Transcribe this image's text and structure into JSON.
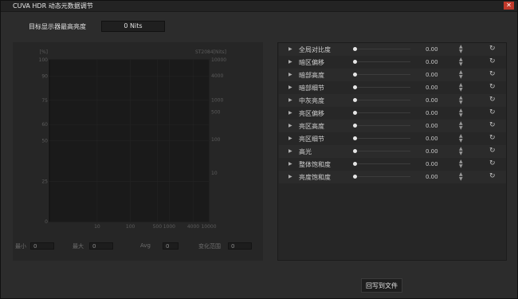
{
  "window": {
    "title": "CUVA HDR 动态元数据调节",
    "close_glyph": "✕"
  },
  "target": {
    "label": "目标显示器最高亮度",
    "value": "0 Nits"
  },
  "chart_data": {
    "type": "line",
    "left_axis": {
      "unit": "[%]",
      "ticks": [
        "100",
        "90",
        "75",
        "60",
        "50",
        "25",
        "0"
      ]
    },
    "right_axis": {
      "unit": "ST2084[Nits]",
      "ticks": [
        "10000",
        "4000",
        "1000",
        "500",
        "100",
        "10"
      ]
    },
    "x_axis": {
      "ticks": [
        "10",
        "100",
        "500",
        "1000",
        "4000",
        "10000"
      ]
    },
    "series": []
  },
  "stats": [
    {
      "label": "最小",
      "value": "0"
    },
    {
      "label": "最大",
      "value": "0"
    },
    {
      "label": "Avg",
      "value": "0"
    },
    {
      "label": "变化范围",
      "value": "0"
    }
  ],
  "params": [
    {
      "label": "全局对比度",
      "value": "0.00"
    },
    {
      "label": "暗区偏移",
      "value": "0.00"
    },
    {
      "label": "暗部高度",
      "value": "0.00"
    },
    {
      "label": "暗部细节",
      "value": "0.00"
    },
    {
      "label": "中灰亮度",
      "value": "0.00"
    },
    {
      "label": "亮区偏移",
      "value": "0.00"
    },
    {
      "label": "亮区高度",
      "value": "0.00"
    },
    {
      "label": "亮区细节",
      "value": "0.00"
    },
    {
      "label": "高光",
      "value": "0.00"
    },
    {
      "label": "整体饱和度",
      "value": "0.00"
    },
    {
      "label": "亮度饱和度",
      "value": "0.00"
    }
  ],
  "icons": {
    "expand": "▶",
    "spin_up": "▲",
    "spin_down": "▼",
    "reset": "↻"
  },
  "actions": {
    "writeback_label": "回写到文件"
  }
}
